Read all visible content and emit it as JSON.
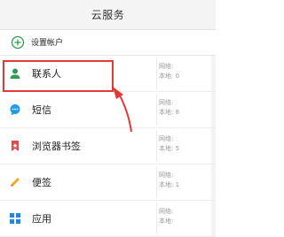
{
  "header": {
    "title": "云服务"
  },
  "account": {
    "label": "设置帐户"
  },
  "stats_labels": {
    "network": "网络:",
    "local": "本地:"
  },
  "items": [
    {
      "label": "联系人",
      "network": "",
      "local": "0",
      "icon": "contact-person-icon",
      "color": "#2e9b54"
    },
    {
      "label": "短信",
      "network": "",
      "local": "8",
      "icon": "message-bubble-icon",
      "color": "#1e9be9"
    },
    {
      "label": "浏览器书签",
      "network": "",
      "local": "5",
      "icon": "bookmark-icon",
      "color": "#e34b4b"
    },
    {
      "label": "便签",
      "network": "",
      "local": "1",
      "icon": "pencil-icon",
      "color": "#f2a623"
    },
    {
      "label": "应用",
      "network": "",
      "local": "",
      "icon": "apps-grid-icon",
      "color": "#1e88e5"
    }
  ],
  "annotation": {
    "color": "#e53935"
  }
}
